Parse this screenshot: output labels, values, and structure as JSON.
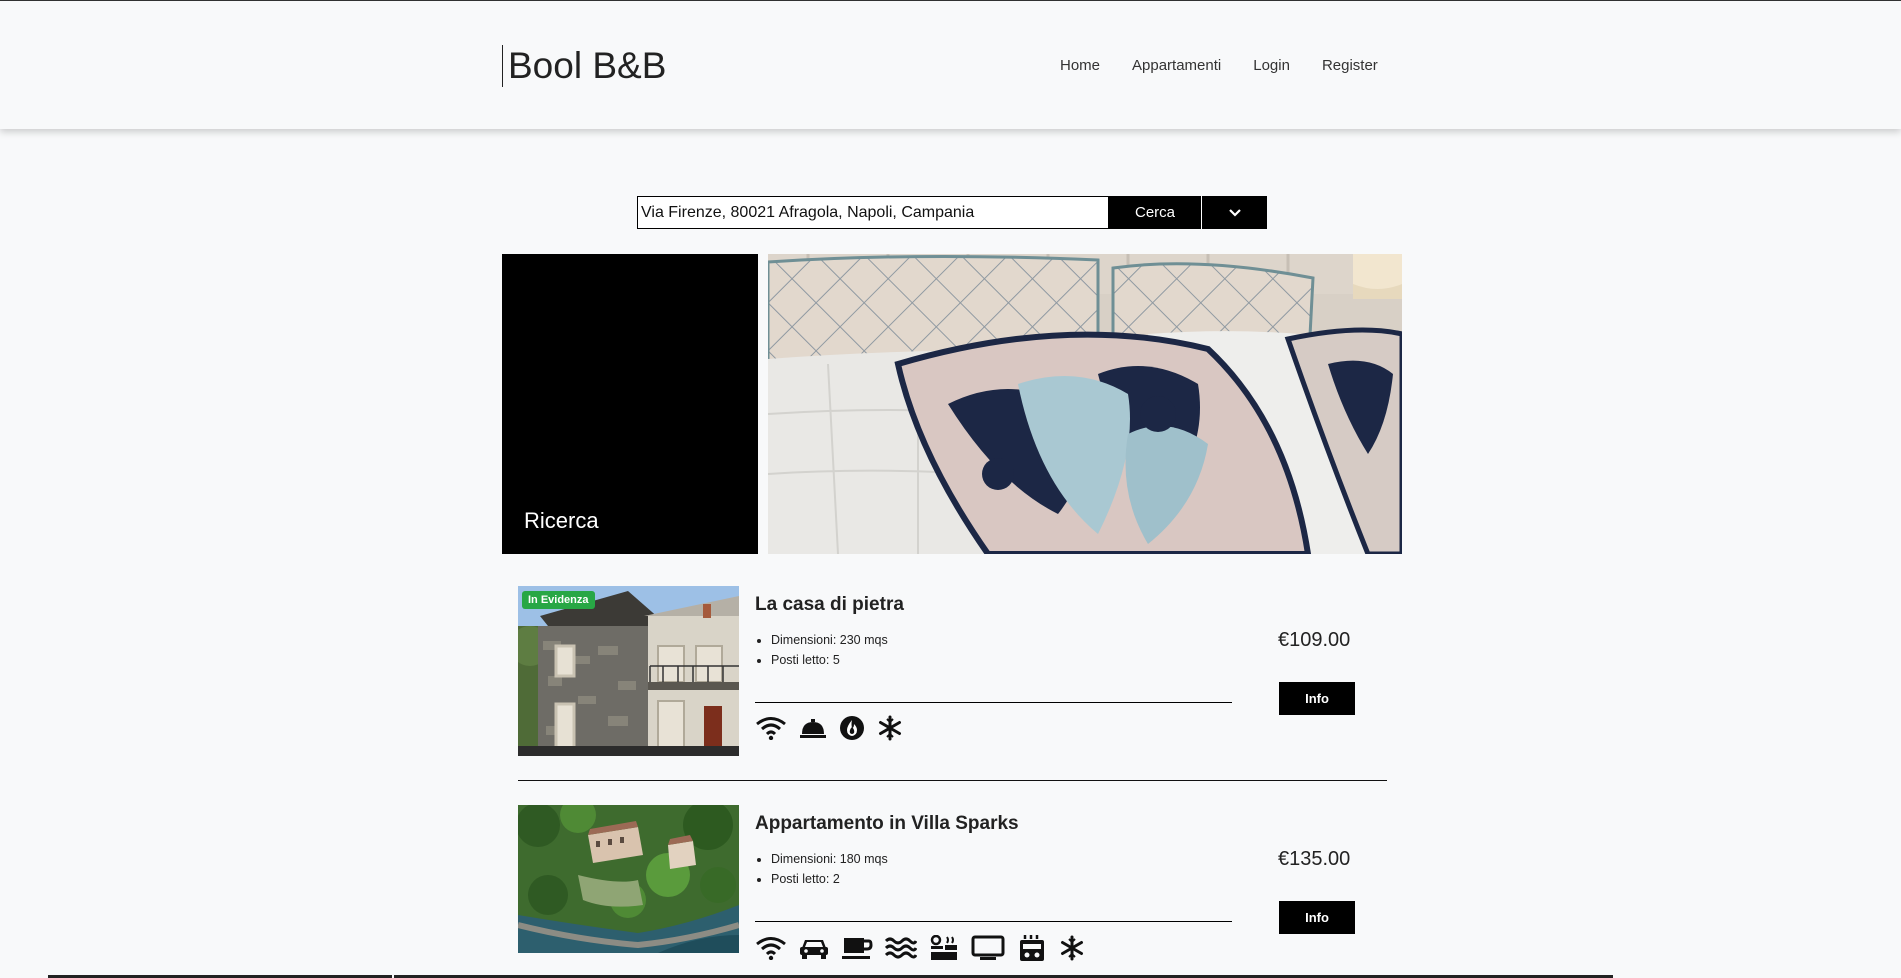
{
  "app": {
    "brand": "Bool B&B"
  },
  "nav": {
    "items": [
      "Home",
      "Appartamenti",
      "Login",
      "Register"
    ]
  },
  "search": {
    "value": "Via Firenze, 80021 Afragola, Napoli, Campania",
    "button": "Cerca",
    "dropdown_icon": "chevron-down-icon"
  },
  "hero": {
    "label": "Ricerca"
  },
  "listings": [
    {
      "badge": "In Evidenza",
      "title": "La casa di pietra",
      "dimensions": "Dimensioni: 230 mqs",
      "beds": "Posti letto: 5",
      "price": "€109.00",
      "info": "Info",
      "amenities": [
        "wifi-icon",
        "concierge-bell-icon",
        "fire-icon",
        "snowflake-icon"
      ]
    },
    {
      "title": "Appartamento in Villa Sparks",
      "dimensions": "Dimensioni: 180 mqs",
      "beds": "Posti letto: 2",
      "price": "€135.00",
      "info": "Info",
      "amenities": [
        "wifi-icon",
        "car-icon",
        "coffee-icon",
        "water-icon",
        "sauna-icon",
        "tv-icon",
        "kitchen-icon",
        "snowflake-icon"
      ]
    }
  ],
  "colors": {
    "accent": "#000000",
    "badge": "#28a745",
    "background": "#f8f9fa"
  }
}
